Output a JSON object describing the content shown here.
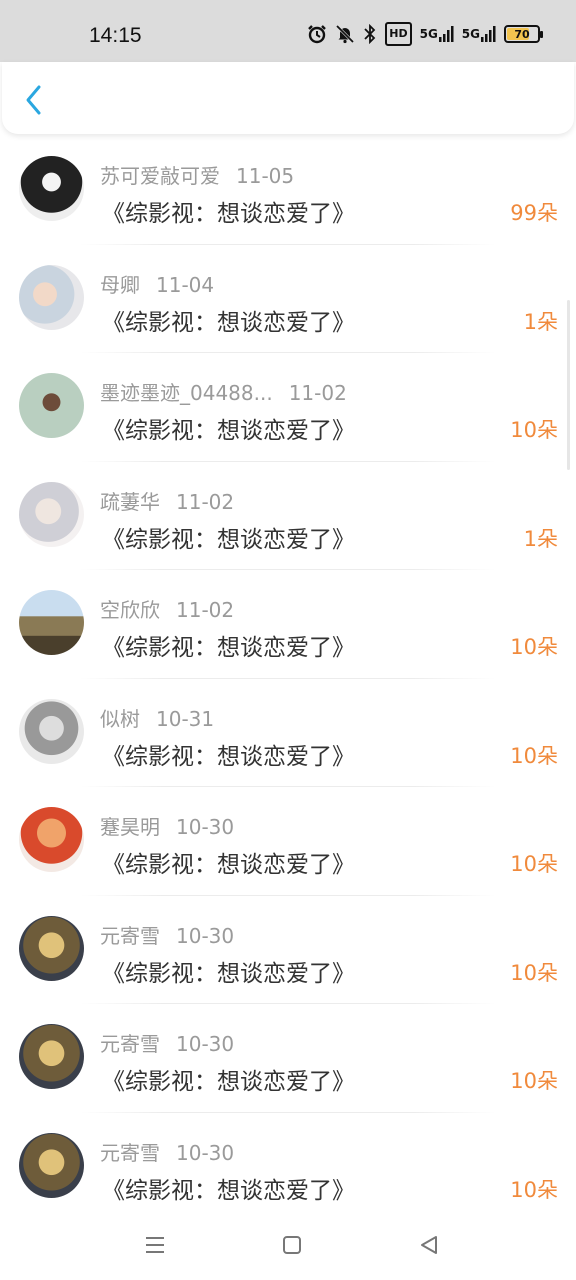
{
  "status_bar": {
    "time": "14:15",
    "hd_label": "HD",
    "signal_1": "5G",
    "signal_2": "5G",
    "battery": "70",
    "battery_level": 0.7
  },
  "header": {
    "back_icon": "chevron-left-icon",
    "accent": "#2aa7e0"
  },
  "colors": {
    "amount": "#f08a3c",
    "name": "#9a9a9a"
  },
  "list": [
    {
      "name": "苏可爱敲可爱",
      "date": "11-05",
      "title": "《综影视：想谈恋爱了》",
      "amount": "99朵"
    },
    {
      "name": "母卿",
      "date": "11-04",
      "title": "《综影视：想谈恋爱了》",
      "amount": "1朵"
    },
    {
      "name": "墨迹墨迹_04488...",
      "date": "11-02",
      "title": "《综影视：想谈恋爱了》",
      "amount": "10朵"
    },
    {
      "name": "疏萋华",
      "date": "11-02",
      "title": "《综影视：想谈恋爱了》",
      "amount": "1朵"
    },
    {
      "name": "空欣欣",
      "date": "11-02",
      "title": "《综影视：想谈恋爱了》",
      "amount": "10朵"
    },
    {
      "name": "似树",
      "date": "10-31",
      "title": "《综影视：想谈恋爱了》",
      "amount": "10朵"
    },
    {
      "name": "蹇昊明",
      "date": "10-30",
      "title": "《综影视：想谈恋爱了》",
      "amount": "10朵"
    },
    {
      "name": "元寄雪",
      "date": "10-30",
      "title": "《综影视：想谈恋爱了》",
      "amount": "10朵"
    },
    {
      "name": "元寄雪",
      "date": "10-30",
      "title": "《综影视：想谈恋爱了》",
      "amount": "10朵"
    },
    {
      "name": "元寄雪",
      "date": "10-30",
      "title": "《综影视：想谈恋爱了》",
      "amount": "10朵"
    }
  ],
  "nav": {
    "menu_icon": "menu-icon",
    "home_icon": "square-home-icon",
    "back_icon": "triangle-back-icon"
  }
}
